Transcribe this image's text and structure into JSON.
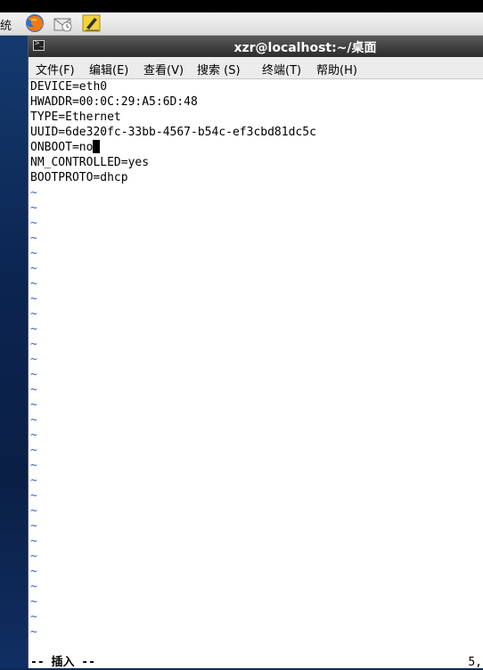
{
  "taskbar": {
    "system_label": "统",
    "launchers": [
      "firefox-icon",
      "mail-icon",
      "notes-icon"
    ]
  },
  "window": {
    "title": "xzr@localhost:~/桌面",
    "menu": [
      {
        "label": "文件(F)"
      },
      {
        "label": "编辑(E)"
      },
      {
        "label": "查看(V)"
      },
      {
        "label": "搜索 (S)"
      },
      {
        "label": "终端(T)"
      },
      {
        "label": "帮助(H)"
      }
    ]
  },
  "editor": {
    "lines": [
      "DEVICE=eth0",
      "HWADDR=00:0C:29:A5:6D:48",
      "TYPE=Ethernet",
      "UUID=6de320fc-33bb-4567-b54c-ef3cbd81dc5c",
      "ONBOOT=no",
      "NM_CONTROLLED=yes",
      "BOOTPROTO=dhcp"
    ],
    "cursor_line": 4,
    "empty_marker": "~",
    "empty_line_count": 30
  },
  "status": {
    "mode": "-- 插入 --",
    "position": "5,"
  },
  "colors": {
    "titlebar": "#3a3a3a",
    "tilde": "#3a5fcd",
    "desktop": "#0d2a55"
  }
}
